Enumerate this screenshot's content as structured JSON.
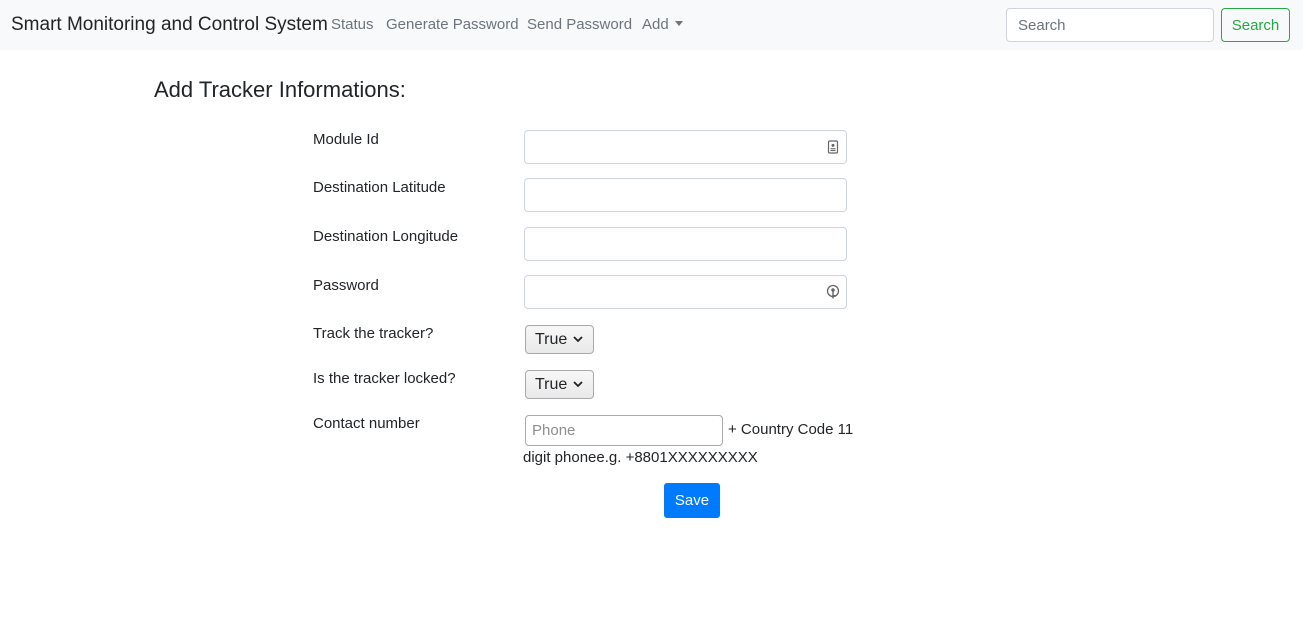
{
  "navbar": {
    "brand": "Smart Monitoring and Control System",
    "links": [
      {
        "label": "Status"
      },
      {
        "label": "Generate Password"
      },
      {
        "label": "Send Password"
      },
      {
        "label": "Add"
      }
    ],
    "search": {
      "placeholder": "Search",
      "button_label": "Search"
    }
  },
  "form": {
    "title": "Add Tracker Informations:",
    "fields": {
      "module_id": {
        "label": "Module Id",
        "value": "",
        "icon": "contact-card-icon"
      },
      "dest_lat": {
        "label": "Destination Latitude",
        "value": ""
      },
      "dest_lon": {
        "label": "Destination Longitude",
        "value": ""
      },
      "password": {
        "label": "Password",
        "value": "",
        "icon": "password-key-icon"
      },
      "track": {
        "label": "Track the tracker?",
        "selected": "True"
      },
      "locked": {
        "label": "Is the tracker locked?",
        "selected": "True"
      },
      "contact": {
        "label": "Contact number",
        "placeholder": "Phone",
        "help_line1": "+ Country Code 11",
        "help_line2": "digit phonee.g. +8801XXXXXXXXX"
      }
    },
    "save_label": "Save"
  },
  "colors": {
    "navbar_bg": "#f8f9fa",
    "primary": "#007bff",
    "success": "#28a745",
    "muted": "#6c757d"
  }
}
